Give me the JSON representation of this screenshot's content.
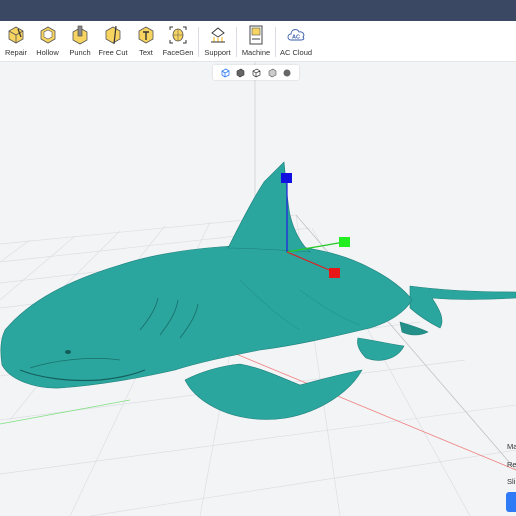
{
  "toolbar": {
    "tools": [
      {
        "label": "Repair",
        "icon": "repair-icon"
      },
      {
        "label": "Hollow",
        "icon": "hollow-icon"
      },
      {
        "label": "Punch",
        "icon": "punch-icon"
      },
      {
        "label": "Free Cut",
        "icon": "free-cut-icon"
      },
      {
        "label": "Text",
        "icon": "text-icon"
      },
      {
        "label": "FaceGen",
        "icon": "facegen-icon"
      },
      {
        "label": "Support",
        "icon": "support-icon"
      },
      {
        "label": "Machine",
        "icon": "machine-icon"
      },
      {
        "label": "AC Cloud",
        "icon": "ac-cloud-icon"
      }
    ]
  },
  "view_controls": [
    "cube-view-icon",
    "solid-view-icon",
    "wire-view-icon",
    "translucent-view-icon",
    "sphere-view-icon"
  ],
  "side_panel": {
    "label_1": "Ma",
    "label_2": "Re",
    "label_3": "Sli"
  },
  "colors": {
    "titlebar": "#3a4863",
    "model": "#2aa69f",
    "accent_icon": "#f2c230",
    "axis_x": "#e02020",
    "axis_y": "#22dd22",
    "axis_z": "#1010e0",
    "button": "#2f7bf6"
  }
}
